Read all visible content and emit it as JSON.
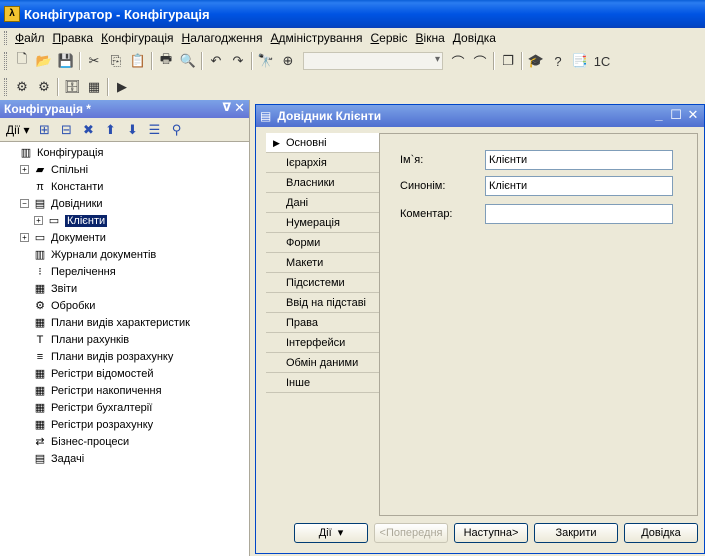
{
  "window": {
    "title": "Конфігуратор - Конфігурація"
  },
  "menu": [
    "Файл",
    "Правка",
    "Конфігурація",
    "Налагодження",
    "Адміністрування",
    "Сервіс",
    "Вікна",
    "Довідка"
  ],
  "left_panel": {
    "title": "Конфігурація *",
    "actions_label": "Дії",
    "tree": [
      {
        "label": "Конфігурація",
        "indent": 0,
        "expander": "",
        "icon": "config-icon"
      },
      {
        "label": "Спільні",
        "indent": 1,
        "expander": "+",
        "icon": "common-icon"
      },
      {
        "label": "Константи",
        "indent": 1,
        "expander": "",
        "icon": "constants-icon"
      },
      {
        "label": "Довідники",
        "indent": 1,
        "expander": "−",
        "icon": "catalogs-icon"
      },
      {
        "label": "Клієнти",
        "indent": 2,
        "expander": "+",
        "icon": "catalog-icon",
        "selected": true
      },
      {
        "label": "Документи",
        "indent": 1,
        "expander": "+",
        "icon": "documents-icon"
      },
      {
        "label": "Журнали документів",
        "indent": 1,
        "expander": "",
        "icon": "journals-icon"
      },
      {
        "label": "Перелічення",
        "indent": 1,
        "expander": "",
        "icon": "enums-icon"
      },
      {
        "label": "Звіти",
        "indent": 1,
        "expander": "",
        "icon": "reports-icon"
      },
      {
        "label": "Обробки",
        "indent": 1,
        "expander": "",
        "icon": "processing-icon"
      },
      {
        "label": "Плани видів характеристик",
        "indent": 1,
        "expander": "",
        "icon": "chart-char-icon"
      },
      {
        "label": "Плани рахунків",
        "indent": 1,
        "expander": "",
        "icon": "chart-accounts-icon"
      },
      {
        "label": "Плани видів розрахунку",
        "indent": 1,
        "expander": "",
        "icon": "chart-calc-icon"
      },
      {
        "label": "Регістри відомостей",
        "indent": 1,
        "expander": "",
        "icon": "info-registers-icon"
      },
      {
        "label": "Регістри накопичення",
        "indent": 1,
        "expander": "",
        "icon": "accum-registers-icon"
      },
      {
        "label": "Регістри бухгалтерії",
        "indent": 1,
        "expander": "",
        "icon": "accounting-registers-icon"
      },
      {
        "label": "Регістри розрахунку",
        "indent": 1,
        "expander": "",
        "icon": "calc-registers-icon"
      },
      {
        "label": "Бізнес-процеси",
        "indent": 1,
        "expander": "",
        "icon": "business-process-icon"
      },
      {
        "label": "Задачі",
        "indent": 1,
        "expander": "",
        "icon": "tasks-icon"
      }
    ]
  },
  "child_window": {
    "title": "Довідник Клієнти",
    "tabs": [
      "Основні",
      "Ієрархія",
      "Власники",
      "Дані",
      "Нумерація",
      "Форми",
      "Макети",
      "Підсистеми",
      "Ввід на підставі",
      "Права",
      "Інтерфейси",
      "Обмін даними",
      "Інше"
    ],
    "fields": {
      "name_label": "Ім`я:",
      "name_value": "Клієнти",
      "synonym_label": "Синонім:",
      "synonym_value": "Клієнти",
      "comment_label": "Коментар:",
      "comment_value": ""
    },
    "buttons": {
      "actions": "Дії",
      "prev": "<Попередня",
      "next": "Наступна>",
      "close": "Закрити",
      "help": "Довідка"
    }
  }
}
